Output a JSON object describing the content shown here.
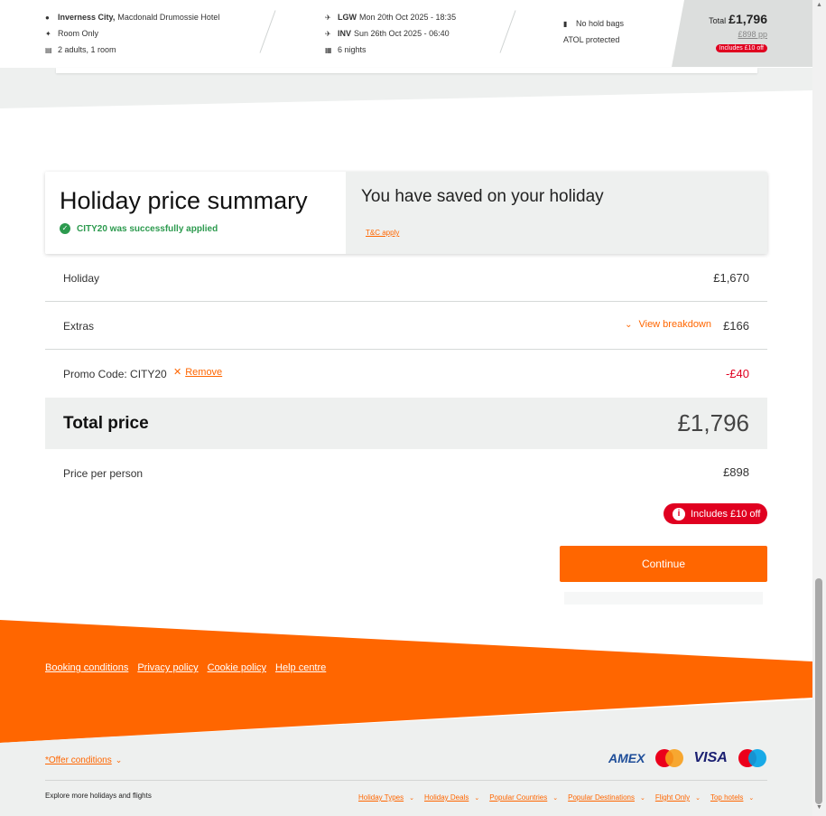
{
  "trip": {
    "destination_bold": "Inverness City,",
    "destination_hotel": "Macdonald Drumossie Hotel",
    "board": "Room Only",
    "party": "2 adults, 1 room",
    "outbound_airport": "LGW",
    "outbound_date": "Mon 20th Oct 2025 - 18:35",
    "return_airport": "INV",
    "return_date": "Sun 26th Oct 2025 - 06:40",
    "nights": "6 nights",
    "bags": "No hold bags",
    "atol": "ATOL protected",
    "total_label": "Total",
    "total_value": "£1,796",
    "per_person": "£898 pp",
    "includes_badge": "Includes £10 off"
  },
  "summary": {
    "title": "Holiday price summary",
    "promo_success": "CITY20 was successfully applied",
    "saved_text": "You have saved on your holiday",
    "tc_link": "T&C apply",
    "rows": {
      "holiday_label": "Holiday",
      "holiday_value": "£1,670",
      "extras_label": "Extras",
      "view_breakdown": "View breakdown",
      "extras_value": "£166",
      "promo_label": "Promo Code: CITY20",
      "remove_label": "Remove",
      "promo_value": "-£40"
    },
    "total_label": "Total price",
    "total_value": "£1,796",
    "pp_label": "Price per person",
    "pp_value": "£898",
    "includes_badge": "Includes £10 off",
    "continue_label": "Continue"
  },
  "footer": {
    "links": [
      "Booking conditions",
      "Privacy policy",
      "Cookie policy",
      "Help centre"
    ],
    "offer_conditions": "*Offer conditions",
    "payments": [
      "AMEX",
      "VISA"
    ],
    "explore": "Explore more holidays and flights",
    "explore_links": [
      "Holiday Types",
      "Holiday Deals",
      "Popular Countries",
      "Popular Destinations",
      "Flight Only",
      "Top hotels"
    ]
  },
  "colors": {
    "brand_orange": "#ff6600",
    "alert_red": "#e00020",
    "success_green": "#2c9a4e",
    "panel_grey": "#eef0ef"
  },
  "icons": [
    "location-pin-icon",
    "fork-knife-icon",
    "bed-icon",
    "plane-takeoff-icon",
    "plane-landing-icon",
    "calendar-icon",
    "luggage-icon",
    "check-circle-icon",
    "chevron-down-icon",
    "close-icon",
    "info-icon"
  ]
}
